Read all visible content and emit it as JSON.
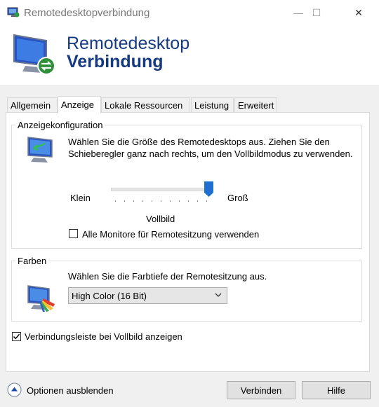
{
  "window": {
    "title": "Remotedesktopverbindung",
    "controls": {
      "minimize": "—",
      "maximize": "☐",
      "close": "✕"
    }
  },
  "banner": {
    "line1": "Remotedesktop",
    "line2": "Verbindung"
  },
  "tabs": [
    {
      "label": "Allgemein",
      "active": false
    },
    {
      "label": "Anzeige",
      "active": true
    },
    {
      "label": "Lokale Ressourcen",
      "active": false
    },
    {
      "label": "Leistung",
      "active": false
    },
    {
      "label": "Erweitert",
      "active": false
    }
  ],
  "display_config": {
    "group_label": "Anzeigekonfiguration",
    "description": "Wählen Sie die Größe des Remotedesktops aus. Ziehen Sie den Schieberegler ganz nach rechts, um den Vollbildmodus zu verwenden.",
    "slider_min_label": "Klein",
    "slider_max_label": "Groß",
    "slider_value_label": "Vollbild",
    "slider_position": 1.0,
    "all_monitors_label": "Alle Monitore für Remotesitzung verwenden",
    "all_monitors_checked": false
  },
  "colors": {
    "group_label": "Farben",
    "description": "Wählen Sie die Farbtiefe der Remotesitzung aus.",
    "selected": "High Color (16 Bit)"
  },
  "connection_bar": {
    "label": "Verbindungsleiste bei Vollbild anzeigen",
    "checked": true
  },
  "footer": {
    "options_label": "Optionen ausblenden",
    "connect_label": "Verbinden",
    "help_label": "Hilfe"
  },
  "theme": {
    "accent": "#1f6fd0",
    "banner_text": "#163a82"
  }
}
